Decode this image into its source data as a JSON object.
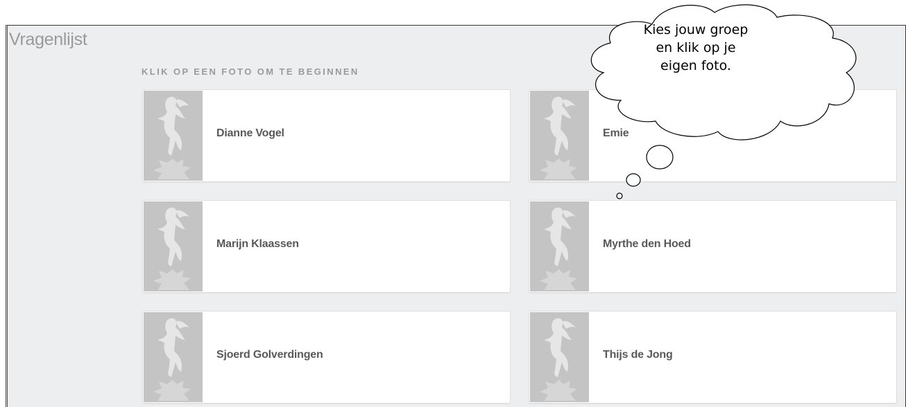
{
  "app": {
    "title": "Vragenlijst"
  },
  "instruction": "KLIK OP EEN FOTO OM TE BEGINNEN",
  "people": [
    {
      "name": "Dianne Vogel"
    },
    {
      "name": "Emie"
    },
    {
      "name": "Marijn Klaassen"
    },
    {
      "name": "Myrthe den Hoed"
    },
    {
      "name": "Sjoerd Golverdingen"
    },
    {
      "name": "Thijs de Jong"
    }
  ],
  "callout": {
    "line1": "Kies jouw groep",
    "line2": "en klik op je",
    "line3": "eigen foto."
  },
  "icons": {
    "avatar": "placeholder-person-silhouette-icon"
  },
  "colors": {
    "background": "#eceeef",
    "card": "#ffffff",
    "photo": "#c4c4c4",
    "name": "#595959",
    "muted": "#9a9a9a"
  }
}
